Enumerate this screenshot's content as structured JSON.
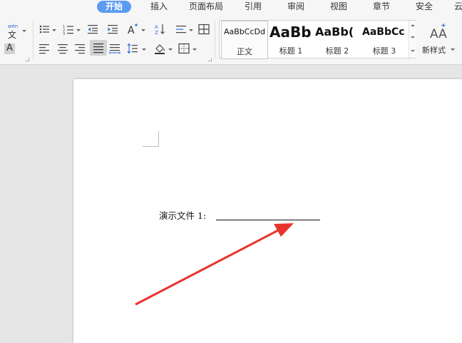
{
  "tabs": {
    "items": [
      "开始",
      "插入",
      "页面布局",
      "引用",
      "审阅",
      "视图",
      "章节",
      "安全",
      "云"
    ],
    "active": "开始"
  },
  "ribbon": {
    "phonetic_label": "wén",
    "char_label": "文",
    "shading_char": "A",
    "styles": [
      {
        "preview": "AaBbCcDd",
        "name": "正文"
      },
      {
        "preview": "AaBb",
        "name": "标题 1"
      },
      {
        "preview": "AaBb(",
        "name": "标题 2"
      },
      {
        "preview": "AaBbCc",
        "name": "标题 3"
      }
    ],
    "new_style_label": "新样式"
  },
  "document": {
    "line_label": "演示文件 1:"
  },
  "colors": {
    "accent": "#5b9bf2",
    "arrow": "#e8332d"
  }
}
